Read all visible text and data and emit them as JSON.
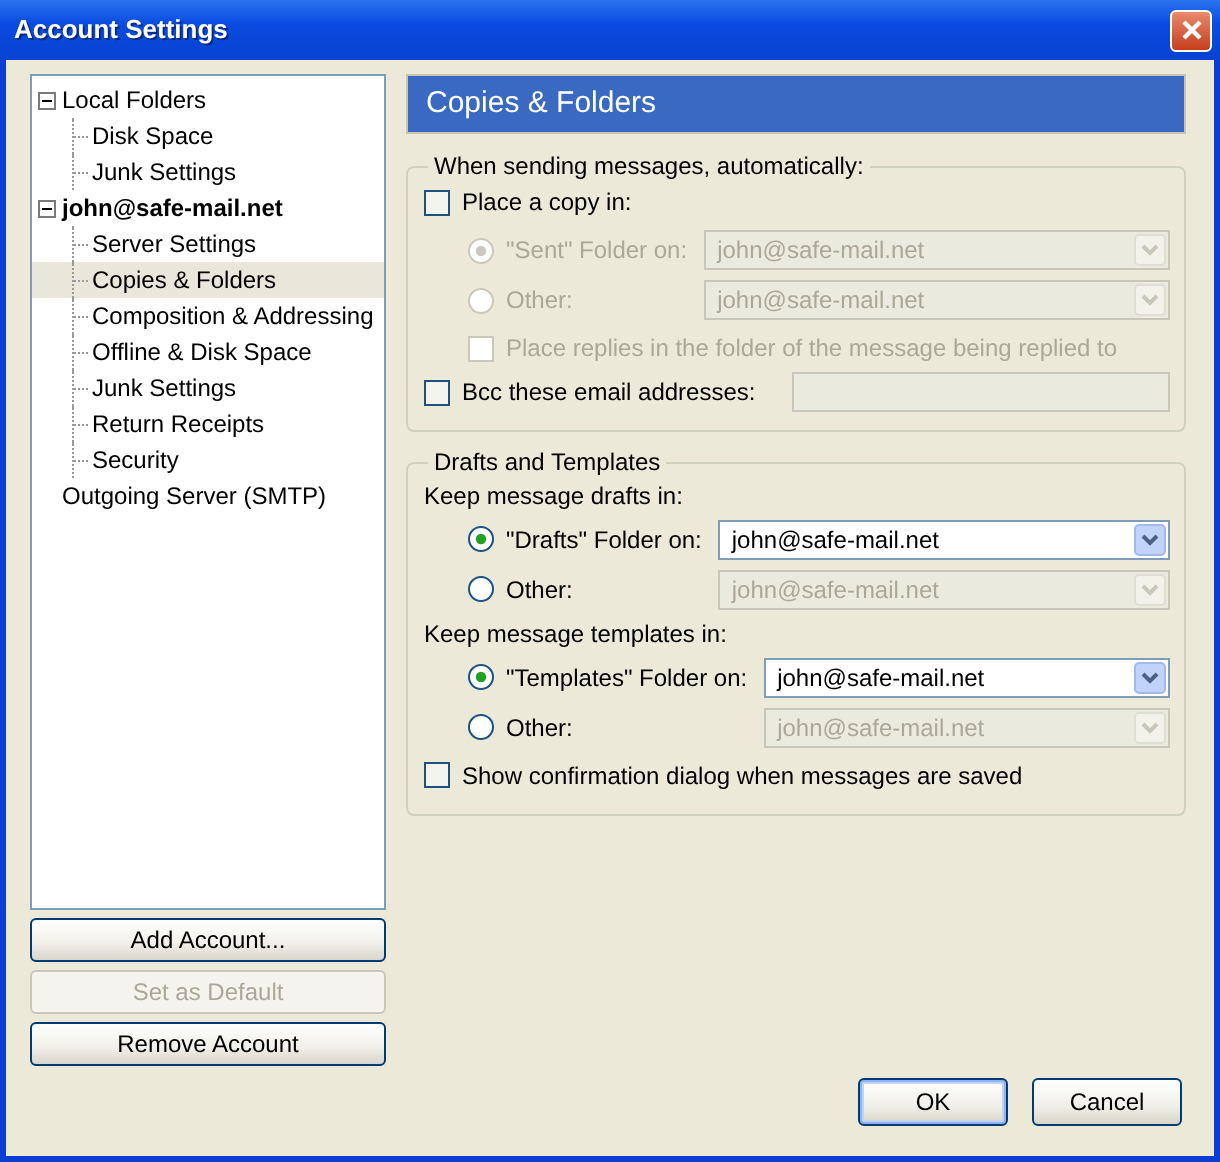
{
  "window": {
    "title": "Account Settings"
  },
  "tree": [
    {
      "label": "Local Folders",
      "kind": "account",
      "expanded": true,
      "selected": false,
      "children": [
        {
          "label": "Disk Space",
          "selected": false
        },
        {
          "label": "Junk Settings",
          "selected": false
        }
      ]
    },
    {
      "label": "john@safe-mail.net",
      "kind": "mail-account",
      "expanded": true,
      "selected": false,
      "children": [
        {
          "label": "Server Settings",
          "selected": false
        },
        {
          "label": "Copies & Folders",
          "selected": true
        },
        {
          "label": "Composition & Addressing",
          "selected": false
        },
        {
          "label": "Offline & Disk Space",
          "selected": false
        },
        {
          "label": "Junk Settings",
          "selected": false
        },
        {
          "label": "Return Receipts",
          "selected": false
        },
        {
          "label": "Security",
          "selected": false
        }
      ]
    },
    {
      "label": "Outgoing Server (SMTP)",
      "kind": "server",
      "selected": false
    }
  ],
  "sidebar_buttons": [
    {
      "label": "Add Account...",
      "disabled": false
    },
    {
      "label": "Set as Default",
      "disabled": true
    },
    {
      "label": "Remove Account",
      "disabled": false
    }
  ],
  "panel": {
    "title": "Copies & Folders",
    "groups": [
      {
        "legend": "When sending messages, automatically:",
        "rows": [
          {
            "kind": "checkbox",
            "label": "Place a copy in:",
            "checked": false,
            "disabled": false
          },
          {
            "kind": "radios",
            "options": [
              {
                "label": "\"Sent\" Folder on:",
                "selected": true,
                "disabled": true,
                "select": {
                  "value": "john@safe-mail.net",
                  "disabled": true
                }
              },
              {
                "label": "Other:",
                "selected": false,
                "disabled": true,
                "select": {
                  "value": "john@safe-mail.net",
                  "disabled": true
                }
              }
            ]
          },
          {
            "kind": "sub-checkbox",
            "label": "Place replies in the folder of the message being replied to",
            "checked": false,
            "disabled": true
          },
          {
            "kind": "checkbox-field",
            "label": "Bcc these email addresses:",
            "checked": false,
            "disabled": false,
            "field_disabled": true
          }
        ]
      },
      {
        "legend": "Drafts and Templates",
        "rows": [
          {
            "kind": "label",
            "label": "Keep message drafts in:"
          },
          {
            "kind": "radios",
            "options": [
              {
                "label": "\"Drafts\" Folder on:",
                "selected": true,
                "disabled": false,
                "select": {
                  "value": "john@safe-mail.net",
                  "disabled": false
                }
              },
              {
                "label": "Other:",
                "selected": false,
                "disabled": false,
                "select": {
                  "value": "john@safe-mail.net",
                  "disabled": true
                }
              }
            ]
          },
          {
            "kind": "label",
            "label": "Keep message templates in:"
          },
          {
            "kind": "radios",
            "options": [
              {
                "label": "\"Templates\" Folder on:",
                "selected": true,
                "disabled": false,
                "select": {
                  "value": "john@safe-mail.net",
                  "disabled": false
                }
              },
              {
                "label": "Other:",
                "selected": false,
                "disabled": false,
                "select": {
                  "value": "john@safe-mail.net",
                  "disabled": true
                }
              }
            ]
          },
          {
            "kind": "checkbox",
            "label": "Show confirmation dialog when messages are saved",
            "checked": false,
            "disabled": false
          }
        ]
      }
    ]
  },
  "dialog_buttons": [
    {
      "label": "OK",
      "default": true
    },
    {
      "label": "Cancel",
      "default": false
    }
  ]
}
